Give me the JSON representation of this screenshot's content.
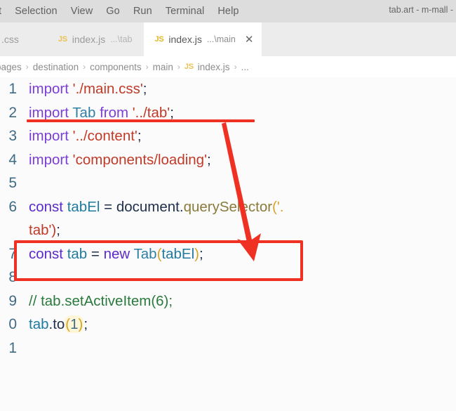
{
  "window": {
    "title": "tab.art - m-mall -"
  },
  "menubar": {
    "items": [
      {
        "label": "t",
        "name": "menu-edit-clipped"
      },
      {
        "label": "Selection",
        "name": "menu-selection"
      },
      {
        "label": "View",
        "name": "menu-view"
      },
      {
        "label": "Go",
        "name": "menu-go"
      },
      {
        "label": "Run",
        "name": "menu-run"
      },
      {
        "label": "Terminal",
        "name": "menu-terminal"
      },
      {
        "label": "Help",
        "name": "menu-help"
      }
    ]
  },
  "tabs": [
    {
      "name": "tab-css",
      "badge": "",
      "label": ".css",
      "path": "",
      "active": false,
      "closable": false
    },
    {
      "name": "tab-index-js-tab",
      "badge": "JS",
      "label": "index.js",
      "path": "...\\tab",
      "active": false,
      "closable": false
    },
    {
      "name": "tab-index-js-main",
      "badge": "JS",
      "label": "index.js",
      "path": "...\\main",
      "active": true,
      "closable": true,
      "close_glyph": "✕"
    }
  ],
  "breadcrumb": {
    "separator": "›",
    "items": [
      {
        "label": "pages",
        "badge": ""
      },
      {
        "label": "destination",
        "badge": ""
      },
      {
        "label": "components",
        "badge": ""
      },
      {
        "label": "main",
        "badge": ""
      },
      {
        "label": "index.js",
        "badge": "JS"
      },
      {
        "label": "...",
        "badge": ""
      }
    ]
  },
  "editor": {
    "line_numbers": [
      "1",
      "2",
      "3",
      "4",
      "5",
      "6",
      "",
      "7",
      "8",
      "9",
      "0",
      "1"
    ],
    "lines": [
      {
        "number": "1",
        "text": "import './main.css';"
      },
      {
        "number": "2",
        "text": "import Tab from '../tab';"
      },
      {
        "number": "3",
        "text": "import '../content';"
      },
      {
        "number": "4",
        "text": "import 'components/loading';"
      },
      {
        "number": "5",
        "text": ""
      },
      {
        "number": "6",
        "text": "const tabEl = document.querySelector('."
      },
      {
        "number": "",
        "text": "tab');"
      },
      {
        "number": "7",
        "text": "const tab = new Tab(tabEl);"
      },
      {
        "number": "8",
        "text": ""
      },
      {
        "number": "9",
        "text": "// tab.setActiveItem(6);"
      },
      {
        "number": "0",
        "text": "tab.to(1);"
      },
      {
        "number": "1",
        "text": ""
      }
    ],
    "tokens": {
      "import": "import",
      "from": "from",
      "const": "const",
      "new": "new",
      "main_css": "'./main.css'",
      "tab_class": "Tab",
      "tab_module": "'../tab'",
      "content_module": "'../content'",
      "loading_module": "'components/loading'",
      "tabEl": "tabEl",
      "document": "document",
      "dot": ".",
      "querySelector": "querySelector",
      "selector_open": "('.",
      "selector_close": "tab')",
      "equals": "=",
      "tab_var": "tab",
      "semicolon": ";",
      "paren_open": "(",
      "paren_close": ")",
      "comment_line": "// tab.setActiveItem(6);",
      "to_call": ".to",
      "to_arg": "1"
    }
  },
  "annotations": {
    "underline_target": "import Tab from '../tab';",
    "box_target": "const tab = new Tab(tabEl);",
    "arrow_color": "#ef3124"
  },
  "colors": {
    "menubar_bg": "#dddddd",
    "tabstrip_bg": "#ececec",
    "active_tab_bg": "#ffffff",
    "editor_bg": "#fbfbfb",
    "keyword": "#7b3fd6",
    "string": "#c03a28",
    "variable": "#1f7a9e",
    "function": "#8a7a3c",
    "comment": "#2a7a3d",
    "paren": "#d8a326",
    "linenumber": "#3f6b84",
    "annotation_red": "#ef3124"
  }
}
